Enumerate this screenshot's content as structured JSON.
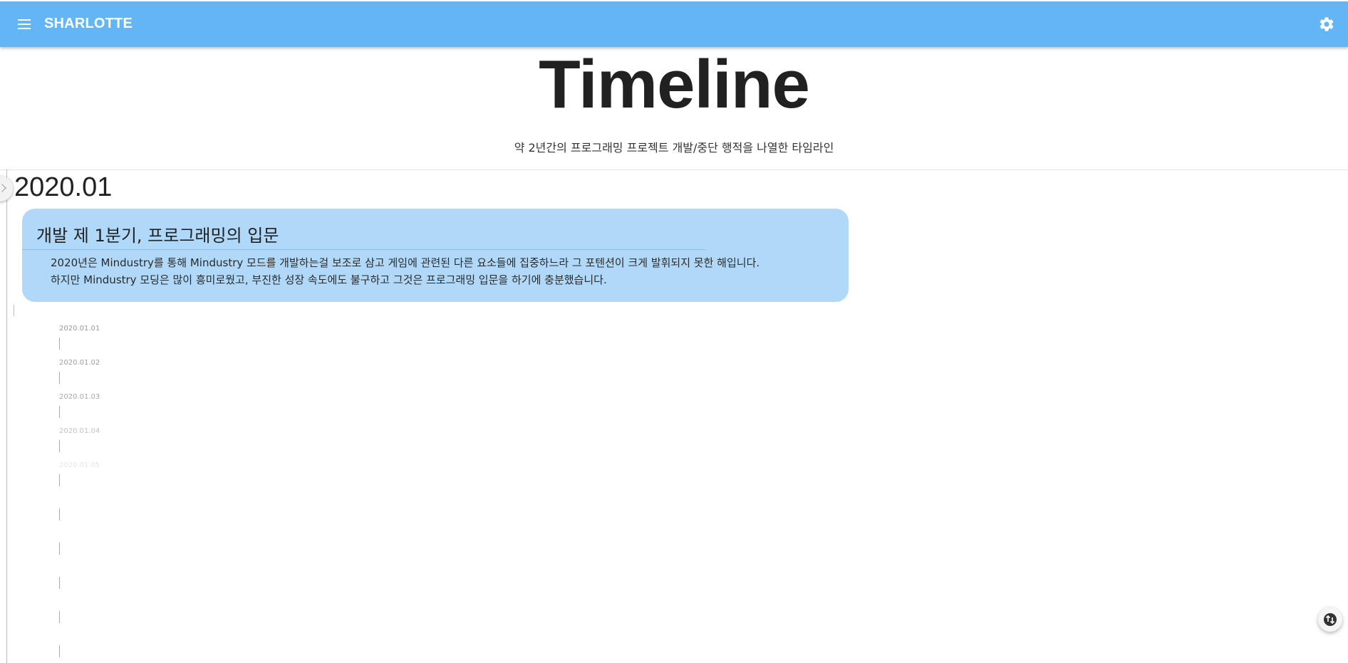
{
  "app": {
    "title": "SHARLOTTE",
    "icons": {
      "menu": "menu-icon",
      "settings": "gear-icon",
      "translate": "translate-icon"
    }
  },
  "hero": {
    "title": "Timeline",
    "subtitle": "약 2년간의 프로그래밍 프로젝트 개발/중단 행적을 나열한 타임라인"
  },
  "timeline": {
    "period": "2020.01",
    "card": {
      "title": "개발 제 1분기, 프로그래밍의 입문",
      "lines": [
        "2020년은 Mindustry를 통해 Mindustry 모드를 개발하는걸 보조로 삼고 게임에 관련된 다른 요소들에 집중하느라 그 포텐션이 크게 발휘되지 못한 해입니다.",
        "하지만 Mindustry 모딩은 많이 흥미로웠고, 부진한 성장 속도에도 불구하고 그것은 프로그래밍 입문을 하기에 충분했습니다."
      ]
    },
    "dates": [
      {
        "label": "2020.01.01",
        "opacity": 1.0
      },
      {
        "label": "2020.01.02",
        "opacity": 0.95
      },
      {
        "label": "2020.01.03",
        "opacity": 0.85
      },
      {
        "label": "2020.01.04",
        "opacity": 0.6
      },
      {
        "label": "2020.01.05",
        "opacity": 0.25
      },
      {
        "label": "",
        "opacity": 0
      },
      {
        "label": "",
        "opacity": 0
      },
      {
        "label": "",
        "opacity": 0
      },
      {
        "label": "",
        "opacity": 0
      },
      {
        "label": "",
        "opacity": 0
      }
    ]
  },
  "colors": {
    "appbar": "#64b5f6",
    "card": "#b0d8f8",
    "timeline_line": "#9ec7ec"
  }
}
